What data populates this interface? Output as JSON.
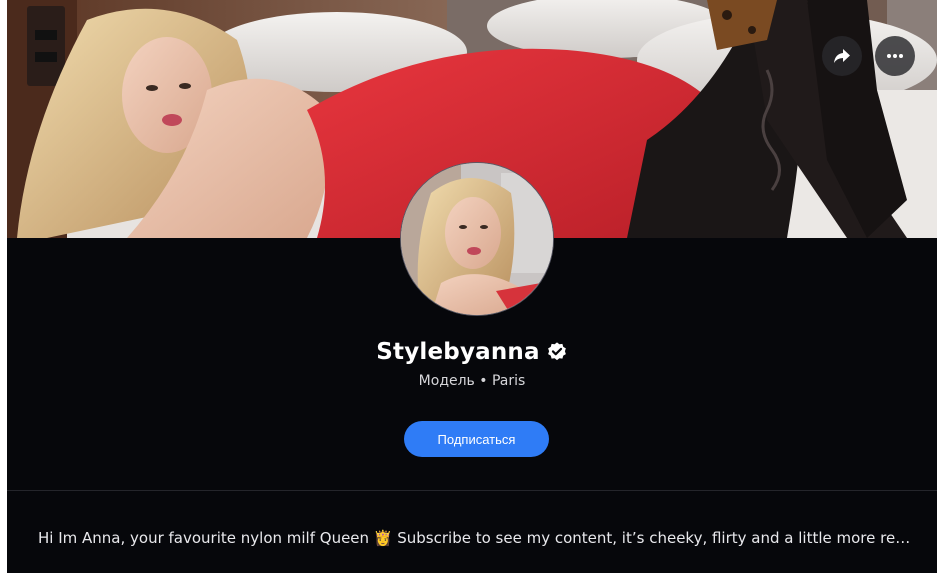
{
  "profile": {
    "name": "Stylebyanna",
    "subtitle": "Модель • Paris",
    "subscribe_label": "Подписаться",
    "bio": "Hi Im Anna, your favourite nylon milf Queen 👸 Subscribe to see my content, it’s cheeky, flirty and a little more reveali…",
    "verified": true
  },
  "cover": {
    "actions": [
      "share-icon",
      "more-icon"
    ]
  },
  "colors": {
    "background": "#06070b",
    "accent": "#2f7cf6",
    "text": "#ffffff",
    "subtext": "#d6d6da"
  }
}
